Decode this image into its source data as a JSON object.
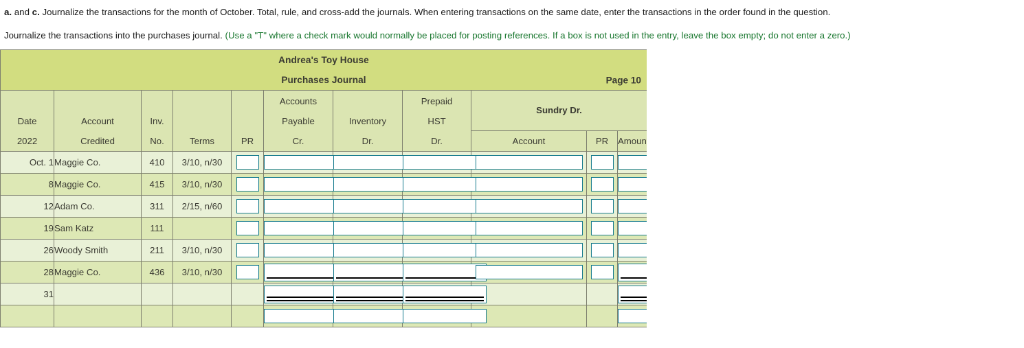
{
  "instructions": {
    "line1_prefix_a": "a.",
    "line1_mid": " and ",
    "line1_prefix_c": "c.",
    "line1_rest": " Journalize the transactions for the month of October. Total, rule, and cross-add the journals. When entering transactions on the same date, enter the transactions in the order found in the question.",
    "line2_black": "Journalize the transactions into the purchases journal. ",
    "line2_green": "(Use a \"T\" where a check mark would normally be placed for posting references. If a box is not used in the entry, leave the box empty; do not enter a zero.)"
  },
  "journal": {
    "company": "Andrea's Toy House",
    "title": "Purchases Journal",
    "page": "Page 10",
    "headers": {
      "date_top": "Date",
      "date_bottom": "2022",
      "account_top": "Account",
      "account_bottom": "Credited",
      "inv_top": "Inv.",
      "inv_bottom": "No.",
      "terms": "Terms",
      "pr": "PR",
      "ap_1": "Accounts",
      "ap_2": "Payable",
      "ap_3": "Cr.",
      "inventory_1": "Inventory",
      "inventory_2": "Dr.",
      "hst_1": "Prepaid",
      "hst_2": "HST",
      "hst_3": "Dr.",
      "sundry": "Sundry Dr.",
      "sundry_account": "Account",
      "sundry_pr": "PR",
      "sundry_amount": "Amount"
    },
    "rows": [
      {
        "date": "Oct. 1",
        "account": "Maggie Co.",
        "inv": "410",
        "terms": "3/10, n/30"
      },
      {
        "date": "8",
        "account": "Maggie Co.",
        "inv": "415",
        "terms": "3/10, n/30"
      },
      {
        "date": "12",
        "account": "Adam Co.",
        "inv": "311",
        "terms": "2/15, n/60"
      },
      {
        "date": "19",
        "account": "Sam Katz",
        "inv": "111",
        "terms": ""
      },
      {
        "date": "26",
        "account": "Woody Smith",
        "inv": "211",
        "terms": "3/10, n/30"
      },
      {
        "date": "28",
        "account": "Maggie Co.",
        "inv": "436",
        "terms": "3/10, n/30"
      },
      {
        "date": "31",
        "account": "",
        "inv": "",
        "terms": ""
      },
      {
        "date": "",
        "account": "",
        "inv": "",
        "terms": ""
      }
    ]
  },
  "colors": {
    "title_band": "#d2dd80",
    "header_cell": "#dbe5b2",
    "row_odd": "#e9f1d7",
    "row_even": "#dde8b5",
    "grid_line": "#7d7f6e",
    "input_border": "#13798c",
    "green_text": "#16752c"
  }
}
